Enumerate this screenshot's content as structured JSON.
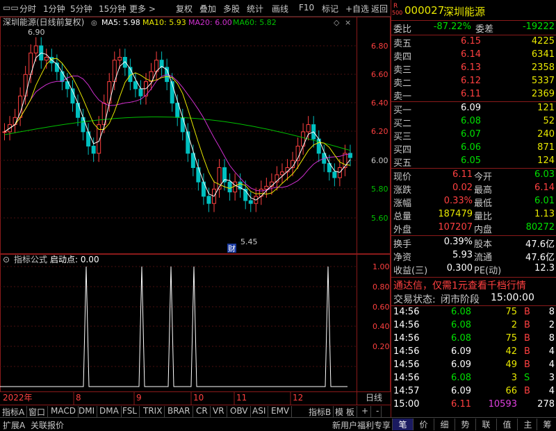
{
  "toolbar": {
    "items": [
      "分时",
      "1分钟",
      "5分钟",
      "15分钟",
      "更多 >",
      "复权",
      "叠加",
      "多股",
      "统计",
      "画线",
      "F10",
      "标记",
      "+自选",
      "返回"
    ]
  },
  "chart": {
    "legend": {
      "name": "深圳能源(日线前复权)",
      "ma5": "MA5: 5.98",
      "ma10": "MA10: 5.93",
      "ma20": "MA20: 6.00",
      "ma60": "MA60: 5.82"
    },
    "high_label": "6.90",
    "low_label": "5.45",
    "cai_label": "财",
    "price_ticks": [
      "6.80",
      "6.60",
      "6.40",
      "6.20",
      "6.00",
      "5.80",
      "5.60"
    ],
    "indicator_title": "指标公式",
    "indicator_sub": "启动点: 0.00",
    "indicator_ticks": [
      "1.00",
      "0.80",
      "0.60",
      "0.40",
      "0.20"
    ],
    "x_labels": [
      "2022年",
      "8",
      "9",
      "10",
      "11",
      "12"
    ],
    "period_label": "日线"
  },
  "chart_data": {
    "type": "line",
    "title": "深圳能源(日线前复权)",
    "ylim": [
      5.45,
      6.9
    ],
    "series": [
      {
        "name": "MA5",
        "values": [
          5.98
        ]
      },
      {
        "name": "MA10",
        "values": [
          5.93
        ]
      },
      {
        "name": "MA20",
        "values": [
          6.0
        ]
      },
      {
        "name": "MA60",
        "values": [
          5.82
        ]
      }
    ],
    "signals": {
      "name": "启动点",
      "ylim": [
        0,
        1
      ],
      "x": [
        "Jul",
        "Aug",
        "Sep",
        "Sep",
        "Oct",
        "Dec"
      ],
      "values": [
        1,
        1,
        1,
        1,
        1,
        1
      ]
    }
  },
  "bottom_tabs": [
    "指标A",
    "窗口",
    "MACD",
    "DMI",
    "DMA",
    "FSL",
    "TRIX",
    "BRAR",
    "CR",
    "VR",
    "OBV",
    "ASI",
    "EMV",
    "指标B",
    "模 板",
    "+",
    "-"
  ],
  "quote": {
    "badge_r": "R",
    "badge_num": "500",
    "code": "000027",
    "name": "深圳能源",
    "weibi_label": "委比",
    "weibi": "-87.22%",
    "weicha_label": "委差",
    "weicha": "-19222",
    "sells": [
      {
        "label": "卖五",
        "price": "6.15",
        "vol": "4225"
      },
      {
        "label": "卖四",
        "price": "6.14",
        "vol": "6341"
      },
      {
        "label": "卖三",
        "price": "6.13",
        "vol": "2358"
      },
      {
        "label": "卖二",
        "price": "6.12",
        "vol": "5337"
      },
      {
        "label": "卖一",
        "price": "6.11",
        "vol": "2369"
      }
    ],
    "buys": [
      {
        "label": "买一",
        "price": "6.09",
        "vol": "121"
      },
      {
        "label": "买二",
        "price": "6.08",
        "vol": "52"
      },
      {
        "label": "买三",
        "price": "6.07",
        "vol": "240"
      },
      {
        "label": "买四",
        "price": "6.06",
        "vol": "871"
      },
      {
        "label": "买五",
        "price": "6.05",
        "vol": "124"
      }
    ],
    "stats": [
      {
        "l1": "现价",
        "v1": "6.11",
        "l2": "今开",
        "v2": "6.03"
      },
      {
        "l1": "涨跌",
        "v1": "0.02",
        "l2": "最高",
        "v2": "6.14"
      },
      {
        "l1": "涨幅",
        "v1": "0.33%",
        "l2": "最低",
        "v2": "6.01"
      },
      {
        "l1": "总量",
        "v1": "187479",
        "l2": "量比",
        "v2": "1.13"
      },
      {
        "l1": "外盘",
        "v1": "107207",
        "l2": "内盘",
        "v2": "80272"
      }
    ],
    "stats2": [
      {
        "l1": "换手",
        "v1": "0.39%",
        "l2": "股本",
        "v2": "47.6亿"
      },
      {
        "l1": "净资",
        "v1": "5.93",
        "l2": "流通",
        "v2": "47.6亿"
      },
      {
        "l1": "收益(三)",
        "v1": "0.300",
        "l2": "PE(动)",
        "v2": "12.3"
      }
    ],
    "promo": "通达信，仅需1元查看千档行情",
    "trade_status_label": "交易状态:",
    "trade_status": "闭市阶段",
    "trade_time": "15:00:00",
    "ticks": [
      {
        "t": "14:56",
        "p": "6.08",
        "v": "75",
        "d": "B",
        "n": "8"
      },
      {
        "t": "14:56",
        "p": "6.08",
        "v": "2",
        "d": "B",
        "n": "2"
      },
      {
        "t": "14:56",
        "p": "6.08",
        "v": "75",
        "d": "B",
        "n": "8"
      },
      {
        "t": "14:56",
        "p": "6.09",
        "v": "42",
        "d": "B",
        "n": "4"
      },
      {
        "t": "14:56",
        "p": "6.09",
        "v": "49",
        "d": "B",
        "n": "4"
      },
      {
        "t": "14:56",
        "p": "6.08",
        "v": "3",
        "d": "S",
        "n": "3"
      },
      {
        "t": "14:57",
        "p": "6.09",
        "v": "66",
        "d": "B",
        "n": "4"
      },
      {
        "t": "15:00",
        "p": "6.11",
        "v": "10593",
        "d": "",
        "n": "278"
      }
    ]
  },
  "status": {
    "left": [
      "扩展A",
      "关联报价"
    ],
    "promo": "新用户福利专享",
    "side_tabs": [
      "笔",
      "价",
      "细",
      "势",
      "联",
      "值",
      "主",
      "筹"
    ]
  }
}
